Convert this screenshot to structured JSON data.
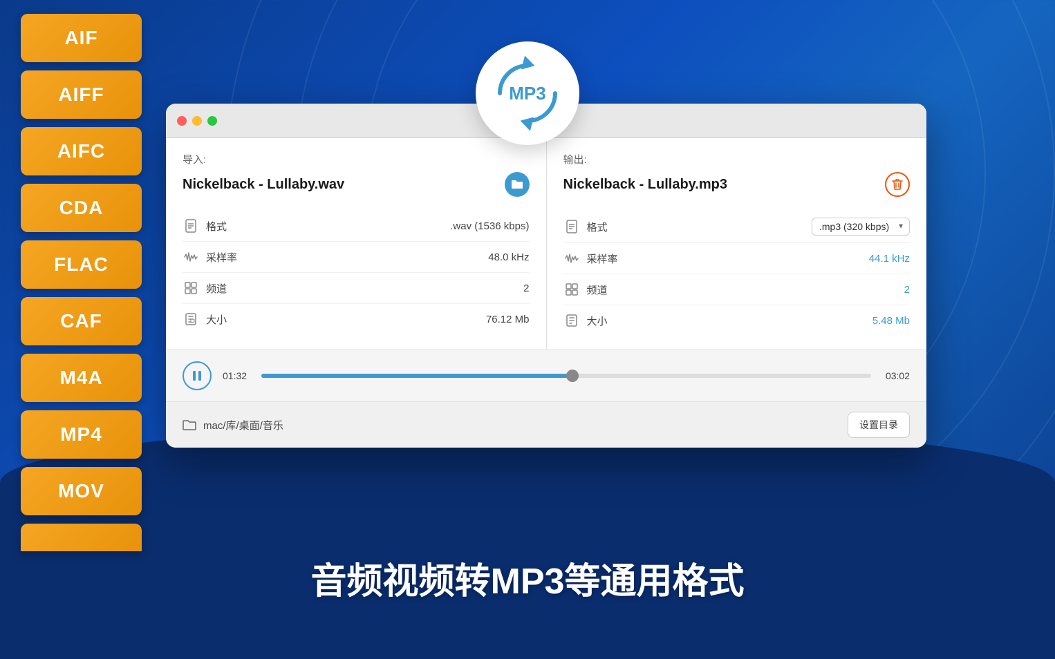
{
  "background": {
    "color_start": "#0a3a8a",
    "color_end": "#1565c0"
  },
  "format_buttons": [
    {
      "label": "AIF"
    },
    {
      "label": "AIFF"
    },
    {
      "label": "AIFC"
    },
    {
      "label": "CDA"
    },
    {
      "label": "FLAC"
    },
    {
      "label": "CAF"
    },
    {
      "label": "M4A"
    },
    {
      "label": "MP4"
    },
    {
      "label": "MOV"
    }
  ],
  "mp3_badge": {
    "text": "MP3"
  },
  "window": {
    "import_label": "导入:",
    "export_label": "输出:",
    "import_filename": "Nickelback - Lullaby.wav",
    "export_filename": "Nickelback - Lullaby.mp3"
  },
  "import_props": [
    {
      "icon": "file-icon",
      "label": "格式",
      "value": ".wav (1536 kbps)"
    },
    {
      "icon": "wave-icon",
      "label": "采样率",
      "value": "48.0 kHz"
    },
    {
      "icon": "channel-icon",
      "label": "频道",
      "value": "2"
    },
    {
      "icon": "size-icon",
      "label": "大小",
      "value": "76.12 Mb"
    }
  ],
  "output_props": [
    {
      "icon": "file-icon",
      "label": "格式",
      "value": ".mp3 (320 kbps)",
      "blue": false,
      "is_select": true
    },
    {
      "icon": "wave-icon",
      "label": "采样率",
      "value": "44.1 kHz",
      "blue": true
    },
    {
      "icon": "channel-icon",
      "label": "频道",
      "value": "2",
      "blue": true
    },
    {
      "icon": "size-icon",
      "label": "大小",
      "value": "5.48 Mb",
      "blue": true
    }
  ],
  "player": {
    "current_time": "01:32",
    "total_time": "03:02",
    "progress_percent": 51
  },
  "footer": {
    "path": "mac/库/桌面/音乐",
    "set_dir_label": "设置目录"
  },
  "bottom_text": "音频视频转MP3等通用格式"
}
